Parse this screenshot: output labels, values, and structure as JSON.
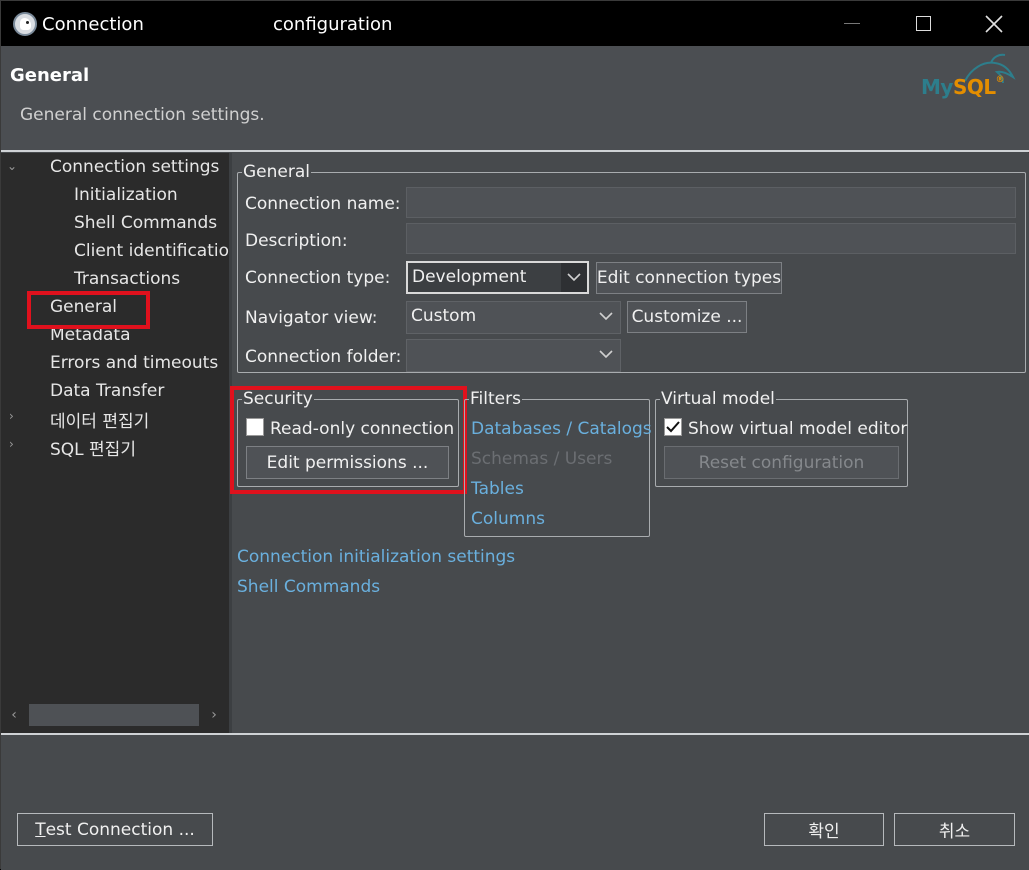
{
  "window": {
    "title_left": "Connection",
    "title_right": "configuration"
  },
  "header": {
    "title": "General",
    "description": "General connection settings.",
    "logo_text_my": "My",
    "logo_text_sql": "SQL",
    "logo_reg": "®"
  },
  "tree": {
    "items": [
      {
        "label": "Connection settings",
        "expanded": true
      },
      {
        "label": "Initialization"
      },
      {
        "label": "Shell Commands"
      },
      {
        "label": "Client identification"
      },
      {
        "label": "Transactions"
      },
      {
        "label": "General",
        "selected": true
      },
      {
        "label": "Metadata"
      },
      {
        "label": "Errors and timeouts"
      },
      {
        "label": "Data Transfer"
      },
      {
        "label": "데이터 편집기",
        "expandable": true
      },
      {
        "label": "SQL 편집기",
        "expandable": true
      }
    ]
  },
  "general_group": {
    "legend": "General",
    "connection_name_label": "Connection name:",
    "connection_name_value": "",
    "description_label": "Description:",
    "description_value": "",
    "connection_type_label": "Connection type:",
    "connection_type_value": "Development",
    "edit_connection_types_label": "Edit connection types",
    "navigator_view_label": "Navigator view:",
    "navigator_view_value": "Custom",
    "customize_label": "Customize ...",
    "connection_folder_label": "Connection folder:",
    "connection_folder_value": ""
  },
  "security_group": {
    "legend": "Security",
    "read_only_label": "Read-only connection",
    "read_only_checked": false,
    "edit_permissions_label": "Edit permissions ..."
  },
  "filters_group": {
    "legend": "Filters",
    "links": [
      {
        "label": "Databases / Catalogs",
        "enabled": true
      },
      {
        "label": "Schemas / Users",
        "enabled": false
      },
      {
        "label": "Tables",
        "enabled": true
      },
      {
        "label": "Columns",
        "enabled": true
      }
    ]
  },
  "virtual_model_group": {
    "legend": "Virtual model",
    "show_editor_label": "Show virtual model editor",
    "show_editor_checked": true,
    "reset_label": "Reset configuration"
  },
  "links": {
    "init_settings": "Connection initialization settings",
    "shell_commands": "Shell Commands"
  },
  "footer": {
    "test_connection_mnemonic": "T",
    "test_connection_rest": "est Connection ...",
    "ok_label": "확인",
    "cancel_label": "취소"
  },
  "colors": {
    "accent_link": "#6ab0de",
    "highlight_red": "#e0111d",
    "background": "#474a4d",
    "tree_background": "#2b2b2b"
  }
}
